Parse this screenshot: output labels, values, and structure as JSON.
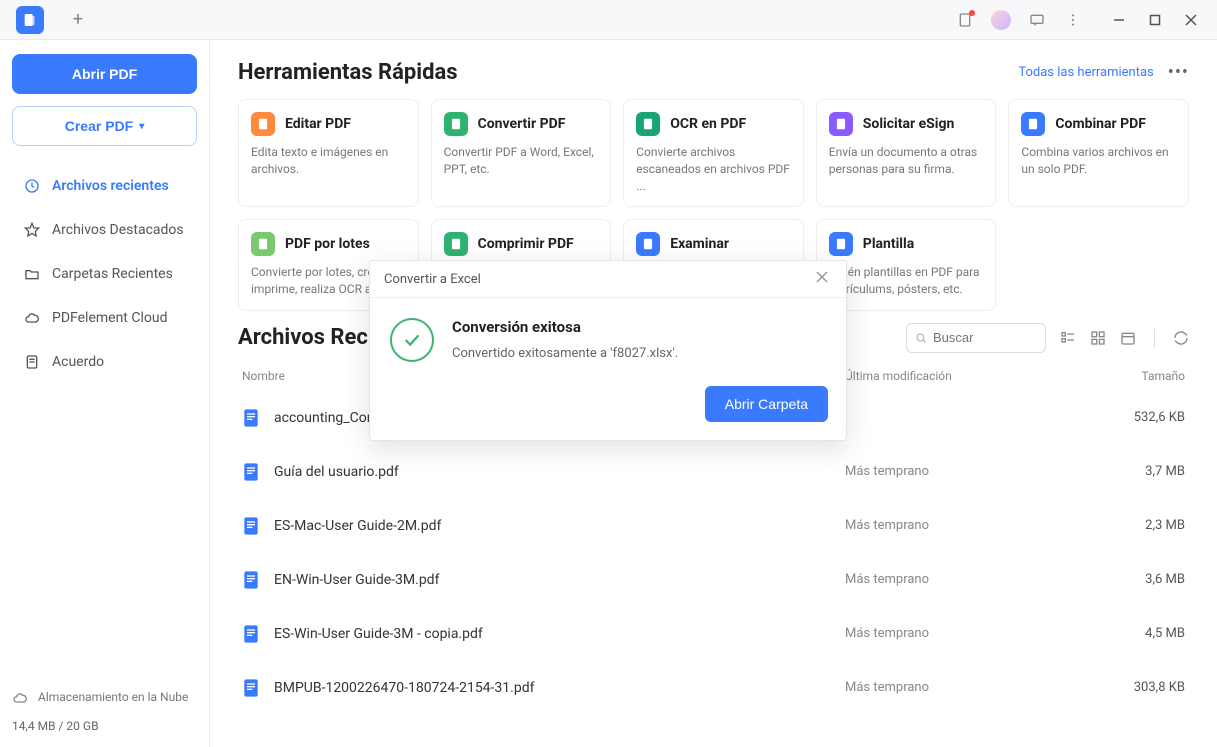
{
  "sidebar": {
    "open_button": "Abrir PDF",
    "create_button": "Crear PDF",
    "nav": {
      "recent": "Archivos recientes",
      "featured": "Archivos Destacados",
      "folders": "Carpetas Recientes",
      "cloud": "PDFelement Cloud",
      "agreement": "Acuerdo"
    },
    "cloud_storage_label": "Almacenamiento en la Nube",
    "storage_usage": "14,4 MB / 20 GB"
  },
  "tools": {
    "title": "Herramientas Rápidas",
    "all_link": "Todas las herramientas",
    "cards": [
      {
        "title": "Editar PDF",
        "desc": "Edita texto e imágenes en archivos.",
        "color": "#ff8a3d"
      },
      {
        "title": "Convertir PDF",
        "desc": "Convertir PDF a Word, Excel, PPT, etc.",
        "color": "#2db36f"
      },
      {
        "title": "OCR en PDF",
        "desc": "Convierte archivos escaneados en archivos PDF ...",
        "color": "#17a673"
      },
      {
        "title": "Solicitar eSign",
        "desc": "Envía un documento a otras personas para su firma.",
        "color": "#8a5cff"
      },
      {
        "title": "Combinar PDF",
        "desc": "Combina varios archivos en un solo PDF.",
        "color": "#3a7afe"
      },
      {
        "title": "PDF por lotes",
        "desc": "Convierte por lotes, crea, imprime, realiza OCR a l...",
        "color": "#7bc96f"
      },
      {
        "title": "Comprimir PDF",
        "desc": "",
        "color": "#2db36f"
      },
      {
        "title": "Examinar",
        "desc": "",
        "color": "#3a7afe"
      },
      {
        "title": "Plantilla",
        "desc": "Obtén plantillas en PDF para currículums, pósters, etc.",
        "color": "#3a7afe"
      }
    ]
  },
  "files": {
    "title": "Archivos Recientes",
    "search_placeholder": "Buscar",
    "columns": {
      "name": "Nombre",
      "mod": "Última modificación",
      "size": "Tamaño"
    },
    "rows": [
      {
        "name": "accounting_Comb...",
        "mod": "",
        "size": "532,6 KB"
      },
      {
        "name": "Guía del usuario.pdf",
        "mod": "Más temprano",
        "size": "3,7 MB"
      },
      {
        "name": "ES-Mac-User Guide-2M.pdf",
        "mod": "Más temprano",
        "size": "2,3 MB"
      },
      {
        "name": "EN-Win-User Guide-3M.pdf",
        "mod": "Más temprano",
        "size": "3,6 MB"
      },
      {
        "name": "ES-Win-User Guide-3M - copia.pdf",
        "mod": "Más temprano",
        "size": "4,5 MB"
      },
      {
        "name": "BMPUB-1200226470-180724-2154-31.pdf",
        "mod": "Más temprano",
        "size": "303,8 KB"
      }
    ]
  },
  "modal": {
    "title": "Convertir a Excel",
    "heading": "Conversión exitosa",
    "message": "Convertido exitosamente a 'f8027.xlsx'.",
    "button": "Abrir Carpeta"
  }
}
